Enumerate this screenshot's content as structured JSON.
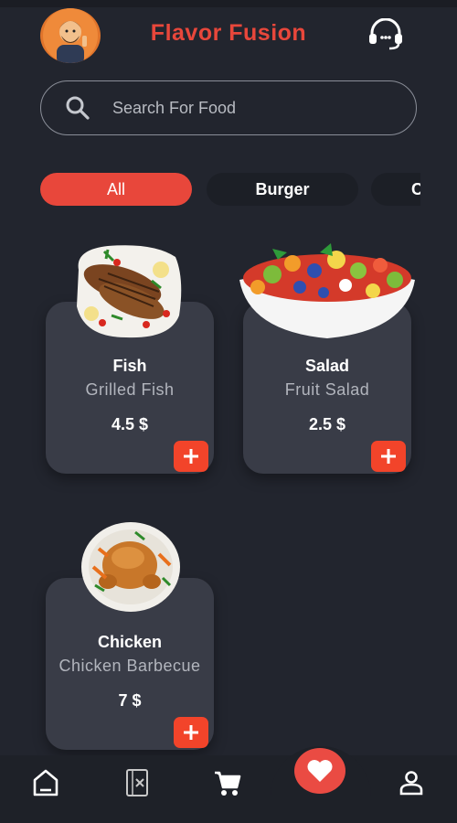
{
  "header": {
    "title": "Flavor Fusion",
    "avatar_icon": "chef-avatar-icon",
    "support_icon": "headset-support-icon"
  },
  "search": {
    "placeholder": "Search For Food",
    "icon": "search-icon"
  },
  "categories": [
    {
      "label": "All",
      "active": true
    },
    {
      "label": "Burger",
      "active": false
    },
    {
      "label": "C",
      "active": false
    }
  ],
  "foods": [
    {
      "name": "Fish",
      "description": "Grilled Fish",
      "price": "4.5 $",
      "image": "grilled-fish-image"
    },
    {
      "name": "Salad",
      "description": "Fruit Salad",
      "price": "2.5 $",
      "image": "fruit-salad-image"
    },
    {
      "name": "Chicken",
      "description": "Chicken Barbecue",
      "price": "7 $",
      "image": "roast-chicken-image"
    }
  ],
  "bottom_nav": [
    {
      "icon": "home-icon"
    },
    {
      "icon": "menu-book-icon"
    },
    {
      "icon": "cart-icon"
    },
    {
      "icon": "heart-icon",
      "active": true
    },
    {
      "icon": "profile-icon"
    }
  ],
  "colors": {
    "background": "#22252e",
    "accent": "#e8473b",
    "card": "#393c47",
    "add_button": "#f2442a"
  }
}
